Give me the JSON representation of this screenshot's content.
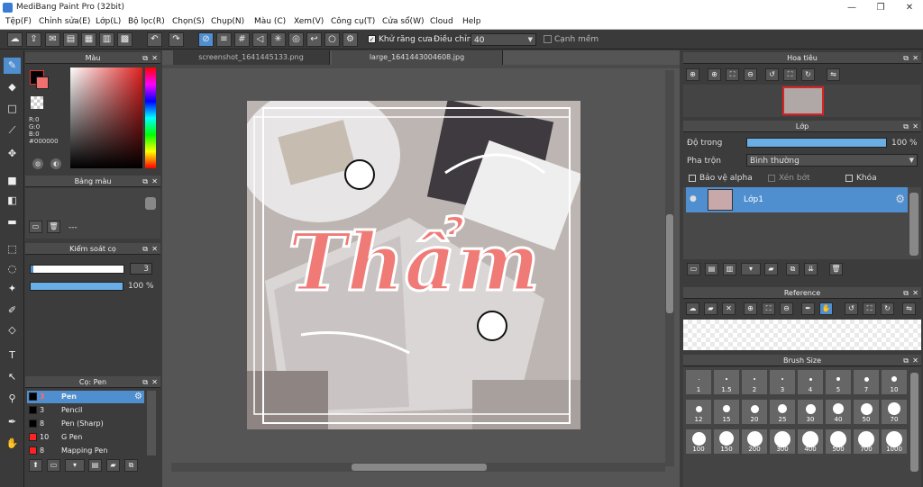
{
  "window": {
    "title": "MediBang Paint Pro (32bit)"
  },
  "menu": [
    "Tệp(F)",
    "Chỉnh sửa(E)",
    "Lớp(L)",
    "Bộ lọc(R)",
    "Chọn(S)",
    "Chụp(N)",
    "Màu (C)",
    "Xem(V)",
    "Công cụ(T)",
    "Cửa sổ(W)",
    "Cloud",
    "Help"
  ],
  "toolbar": {
    "antialias_label": "Khử răng cưa",
    "adjust_label": "Điều chỉnh",
    "adjust_value": "40",
    "snap_label": "Cạnh mềm"
  },
  "color_panel": {
    "title": "Màu",
    "r": "R:0",
    "g": "G:0",
    "b": "B:0",
    "hex": "#000000"
  },
  "palette_panel": {
    "title": "Bảng màu",
    "footer": "---"
  },
  "brush_control": {
    "title": "Kiểm soát cọ",
    "size": "3",
    "opacity": "100 %"
  },
  "brush_panel": {
    "title": "Cọ: Pen",
    "items": [
      {
        "size": "3",
        "name": "Pen",
        "color": "#000000"
      },
      {
        "size": "3",
        "name": "Pencil",
        "color": "#000000"
      },
      {
        "size": "8",
        "name": "Pen (Sharp)",
        "color": "#000000"
      },
      {
        "size": "10",
        "name": "G Pen",
        "color": "#ff2222"
      },
      {
        "size": "8",
        "name": "Mapping Pen",
        "color": "#ff2222"
      }
    ]
  },
  "tabs": [
    "screenshot_1641445133.png",
    "large_1641443004608.jpg"
  ],
  "navigator": {
    "title": "Hoa tiêu"
  },
  "layer_panel": {
    "title": "Lớp",
    "opacity_label": "Độ trong",
    "opacity_value": "100 %",
    "blend_label": "Pha trộn",
    "blend_value": "Bình thường",
    "protect_alpha": "Bảo vệ alpha",
    "clipping": "Xén bớt",
    "lock": "Khóa",
    "layer_name": "Lớp1"
  },
  "reference_panel": {
    "title": "Reference"
  },
  "brush_size_panel": {
    "title": "Brush Size",
    "sizes": [
      "1",
      "1.5",
      "2",
      "3",
      "4",
      "5",
      "7",
      "10",
      "12",
      "15",
      "20",
      "25",
      "30",
      "40",
      "50",
      "70",
      "100",
      "150",
      "200",
      "300",
      "400",
      "500",
      "700",
      "1000"
    ]
  },
  "artwork": {
    "word": "Thẩm"
  },
  "colors": {
    "accent": "#4f8fd0",
    "artwork_pink": "#f07a76"
  }
}
